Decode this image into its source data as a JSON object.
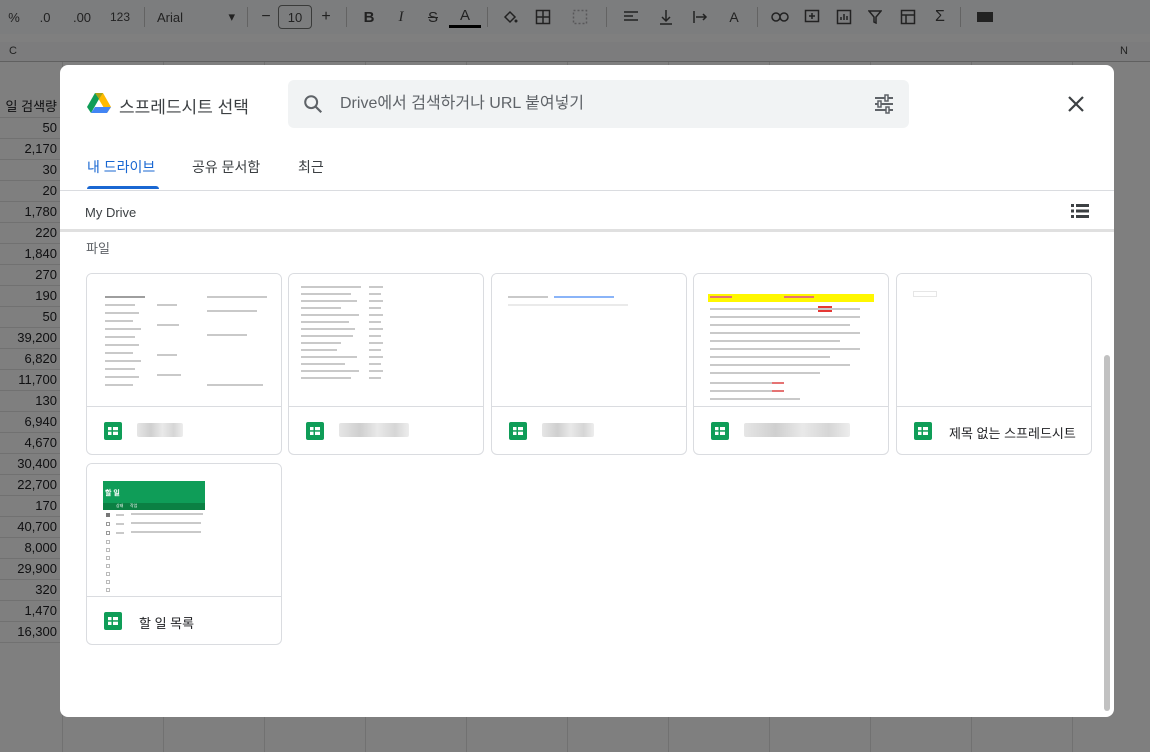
{
  "toolbar": {
    "percent": "%",
    "dec_decrease": ".0",
    "dec_increase": ".00",
    "number_format": "123",
    "font_name": "Arial",
    "font_size": "10",
    "minus": "−",
    "plus": "+"
  },
  "sheet": {
    "col_c": "C",
    "col_n": "N",
    "header_text": "일 검색량",
    "values": [
      "50",
      "2,170",
      "30",
      "20",
      "1,780",
      "220",
      "1,840",
      "270",
      "190",
      "50",
      "39,200",
      "6,820",
      "11,700",
      "130",
      "6,940",
      "4,670",
      "30,400",
      "22,700",
      "170",
      "40,700",
      "8,000",
      "29,900",
      "320",
      "1,470",
      "16,300"
    ]
  },
  "dialog": {
    "title": "스프레드시트 선택",
    "search_placeholder": "Drive에서 검색하거나 URL 붙여넣기",
    "tabs": [
      {
        "label": "내 드라이브",
        "active": true
      },
      {
        "label": "공유 문서함",
        "active": false
      },
      {
        "label": "최근",
        "active": false
      }
    ],
    "breadcrumb": "My Drive",
    "section_label": "파일",
    "files": [
      {
        "name": "",
        "redacted": true
      },
      {
        "name": "",
        "redacted": true
      },
      {
        "name": "",
        "redacted": true
      },
      {
        "name": "",
        "redacted": true
      },
      {
        "name": "제목 없는 스프레드시트",
        "redacted": false
      },
      {
        "name": "할 일 목록",
        "redacted": false
      }
    ],
    "todo_thumb": {
      "title": "할 일",
      "col_status": "상태",
      "col_task": "작업"
    }
  },
  "colors": {
    "accent": "#1967d2",
    "sheets_green": "#0f9d58",
    "overlay": "rgba(0,0,0,0.5)"
  }
}
